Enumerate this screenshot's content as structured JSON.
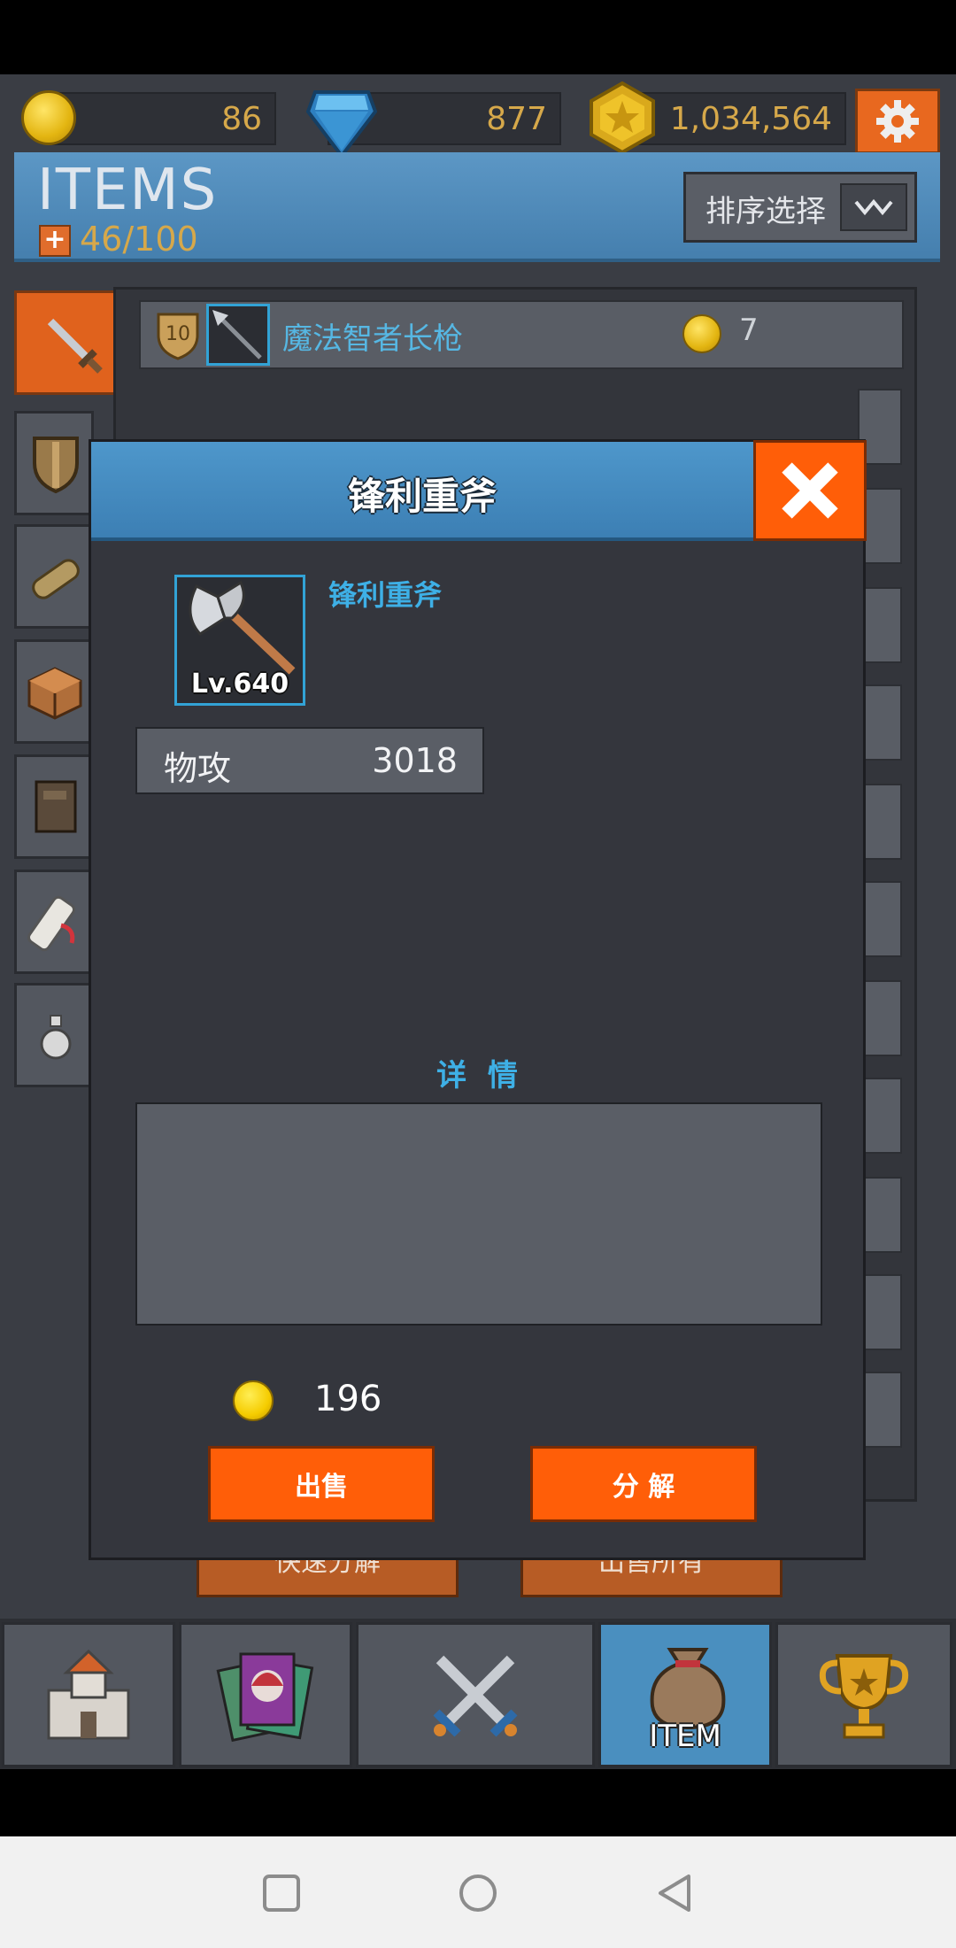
{
  "currencies": {
    "coin": "86",
    "gem": "877",
    "gold": "1,034,564"
  },
  "header": {
    "title": "ITEMS",
    "capacity": "46/100",
    "sort_label": "排序选择"
  },
  "list": {
    "first_item": {
      "level": "10",
      "name": "魔法智者长枪",
      "count": "7"
    }
  },
  "bottom_actions": {
    "quick_decompose": "快速分解",
    "sell_all": "出售所有"
  },
  "nav": {
    "item_label": "ITEM"
  },
  "modal": {
    "title": "锋利重斧",
    "item_name": "锋利重斧",
    "level": "Lv.640",
    "stat_name": "物攻",
    "stat_value": "3018",
    "details_title": "详 情",
    "price": "196",
    "sell_label": "出售",
    "decompose_label": "分 解"
  },
  "colors": {
    "accent_orange": "#ff5e08",
    "header_blue": "#4e97cb",
    "currency_text": "#d6a84a",
    "name_blue": "#3eb0e6"
  }
}
